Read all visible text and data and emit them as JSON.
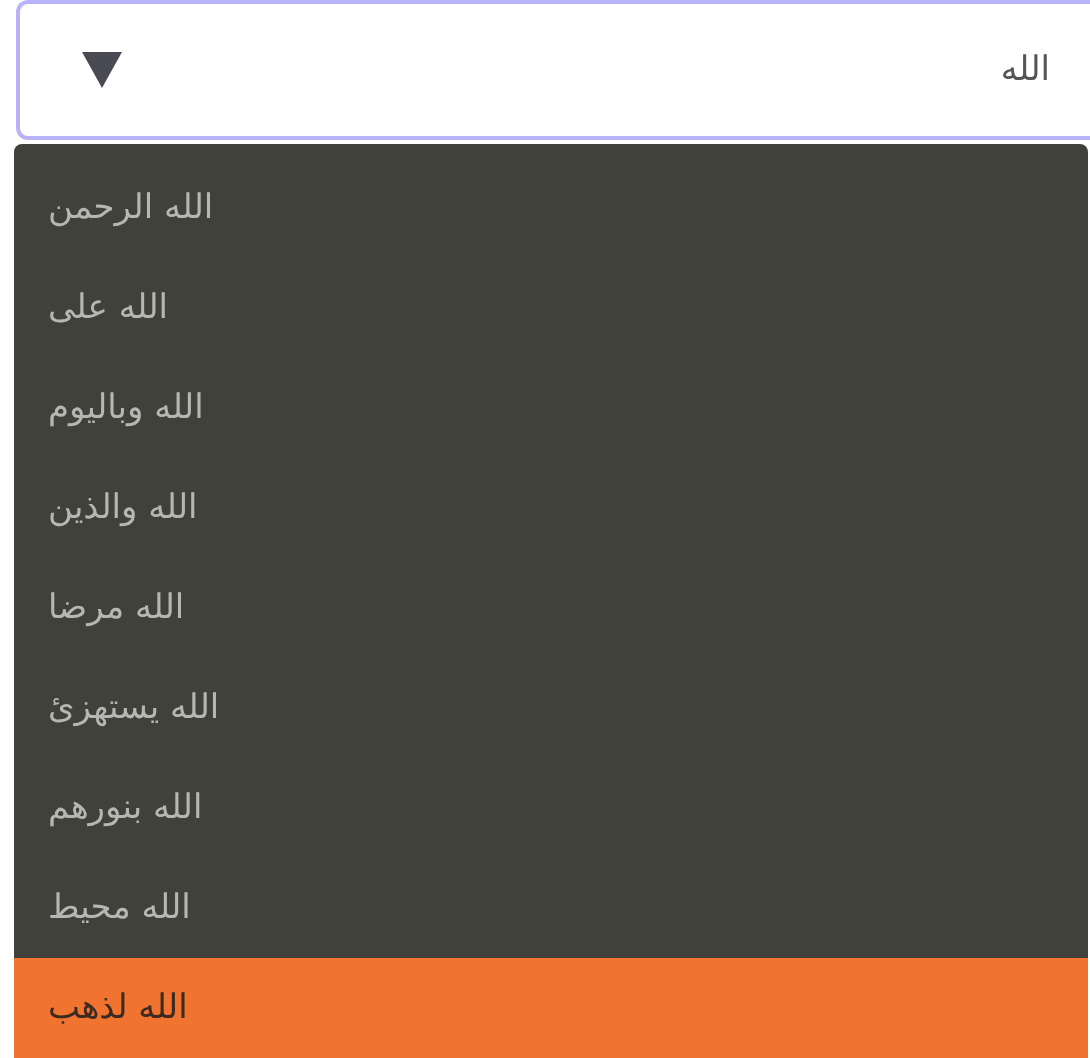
{
  "search": {
    "value": "الله"
  },
  "options": [
    {
      "label": "الله الرحمن",
      "selected": false
    },
    {
      "label": "الله على",
      "selected": false
    },
    {
      "label": "الله وباليوم",
      "selected": false
    },
    {
      "label": "الله والذين",
      "selected": false
    },
    {
      "label": "الله مرضا",
      "selected": false
    },
    {
      "label": "الله يستهزئ",
      "selected": false
    },
    {
      "label": "الله بنورهم",
      "selected": false
    },
    {
      "label": "الله محيط",
      "selected": false
    },
    {
      "label": "الله لذهب",
      "selected": true
    }
  ]
}
